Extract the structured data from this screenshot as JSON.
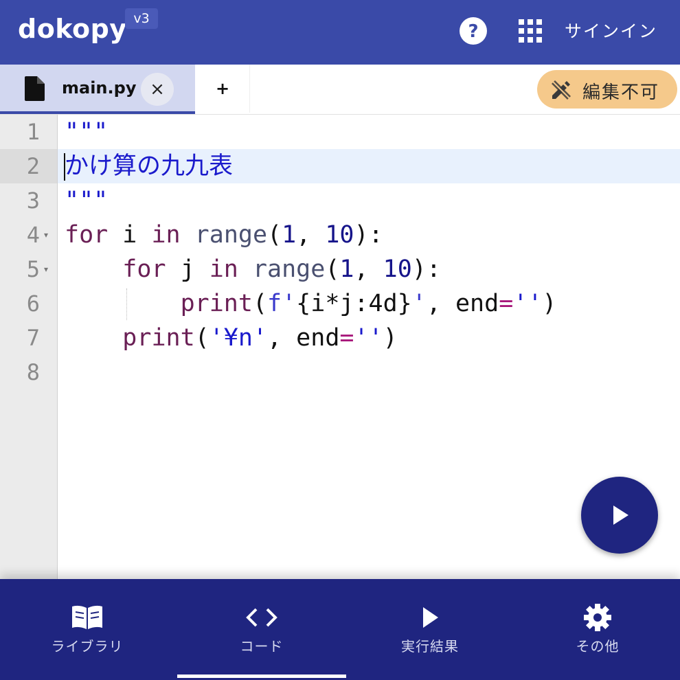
{
  "header": {
    "logo": "dokopy",
    "version": "v3",
    "help_icon": "help-circle-icon",
    "apps_icon": "apps-grid-icon",
    "signin_label": "サインイン"
  },
  "tabs": {
    "active_tab": {
      "label": "main.py",
      "icon": "file-icon",
      "close_label": "×"
    },
    "add_tab_label": "+",
    "readonly_badge": {
      "label": "編集不可",
      "icon": "edit-off-icon",
      "color": "#f5c98b"
    }
  },
  "editor": {
    "line_numbers": [
      "1",
      "2",
      "3",
      "4",
      "5",
      "6",
      "7",
      "8"
    ],
    "fold_marker": "▾",
    "active_line": 2,
    "lines": {
      "l1": {
        "docq": "\"\"\""
      },
      "l2": {
        "text": "かけ算の九九表"
      },
      "l3": {
        "docq": "\"\"\""
      },
      "l4": {
        "kw_for": "for",
        "var": " i ",
        "kw_in": "in",
        "sp": " ",
        "fn": "range",
        "p1": "(",
        "n1": "1",
        "comma": ", ",
        "n2": "10",
        "p2": "):"
      },
      "l5": {
        "indent": "    ",
        "kw_for": "for",
        "var": " j ",
        "kw_in": "in",
        "sp": " ",
        "fn": "range",
        "p1": "(",
        "n1": "1",
        "comma": ", ",
        "n2": "10",
        "p2": "):"
      },
      "l6": {
        "indent": "        ",
        "fn": "print",
        "p1": "(",
        "fs": "f'",
        "expr": "{i*j:4d}",
        "fe": "'",
        "comma": ", end",
        "eq": "=",
        "s": "''",
        "p2": ")"
      },
      "l7": {
        "indent": "    ",
        "fn": "print",
        "p1": "(",
        "s1": "'¥n'",
        "comma": ", end",
        "eq": "=",
        "s2": "''",
        "p2": ")"
      },
      "l8": {}
    }
  },
  "run_button": {
    "icon": "play-icon"
  },
  "bottom_nav": {
    "items": [
      {
        "label": "ライブラリ",
        "icon": "book-open-icon"
      },
      {
        "label": "コード",
        "icon": "code-icon"
      },
      {
        "label": "実行結果",
        "icon": "play-icon"
      },
      {
        "label": "その他",
        "icon": "gear-icon"
      }
    ],
    "selected_index": 1
  },
  "colors": {
    "header_bg": "#3a4aa8",
    "nav_bg": "#1f2580",
    "tab_active_bg": "#d2d7f0",
    "string": "#1a1acc",
    "keyword": "#770088",
    "number": "#16148a"
  }
}
